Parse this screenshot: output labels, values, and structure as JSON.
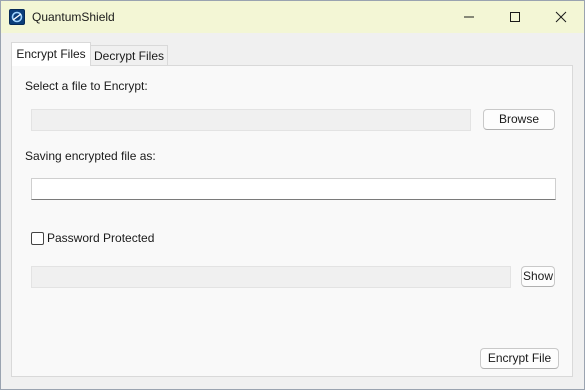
{
  "window": {
    "title": "QuantumShield",
    "app_icon": "quantumshield-logo-icon",
    "controls": {
      "minimize_icon": "minimize-icon",
      "maximize_icon": "maximize-icon",
      "close_icon": "close-icon"
    },
    "titlebar_color": "#f3f6d5"
  },
  "tabs": [
    {
      "label": "Encrypt Files",
      "selected": true
    },
    {
      "label": "Decrypt Files",
      "selected": false
    }
  ],
  "encrypt_panel": {
    "select_file_label": "Select a file to Encrypt:",
    "file_path_value": "",
    "browse_label": "Browse",
    "save_as_label": "Saving encrypted file as:",
    "save_as_value": "",
    "password_checkbox_label": "Password Protected",
    "password_checked": false,
    "password_value": "",
    "show_label": "Show",
    "encrypt_label": "Encrypt File"
  }
}
